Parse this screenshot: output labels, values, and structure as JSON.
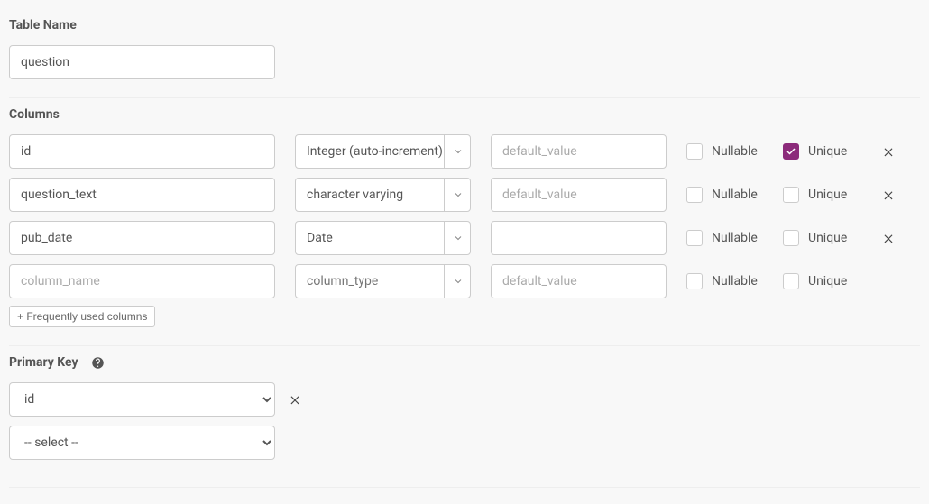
{
  "tableName": {
    "label": "Table Name",
    "value": "question"
  },
  "columns": {
    "label": "Columns",
    "placeholders": {
      "name": "column_name",
      "type": "column_type",
      "default": "default_value"
    },
    "labels": {
      "nullable": "Nullable",
      "unique": "Unique"
    },
    "rows": [
      {
        "name": "id",
        "type": "Integer (auto-increment)",
        "default": "",
        "defaultPlaceholder": "default_value",
        "nullable": false,
        "unique": true,
        "removable": true
      },
      {
        "name": "question_text",
        "type": "character varying",
        "default": "",
        "defaultPlaceholder": "default_value",
        "nullable": false,
        "unique": false,
        "removable": true
      },
      {
        "name": "pub_date",
        "type": "Date",
        "default": "",
        "defaultPlaceholder": "",
        "nullable": false,
        "unique": false,
        "removable": true
      },
      {
        "name": "",
        "type": "",
        "default": "",
        "defaultPlaceholder": "default_value",
        "nullable": false,
        "unique": false,
        "removable": false
      }
    ],
    "freqButton": "+ Frequently used columns"
  },
  "primaryKey": {
    "label": "Primary Key",
    "rows": [
      {
        "value": "id",
        "removable": true
      },
      {
        "value": "-- select --",
        "removable": false
      }
    ]
  }
}
